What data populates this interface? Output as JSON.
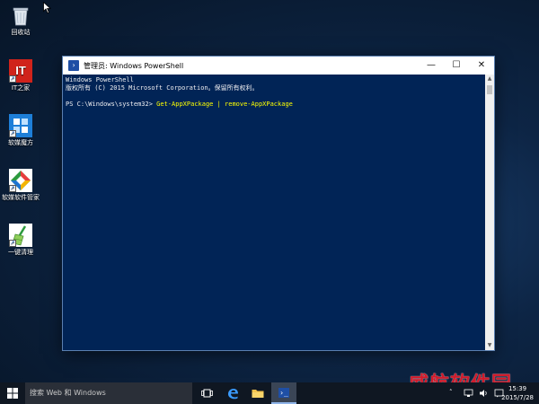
{
  "desktop": {
    "icons": [
      {
        "label": "回收站"
      },
      {
        "label": "IT之家",
        "glyph_text": "IT"
      },
      {
        "label": "软媒魔方"
      },
      {
        "label": "软媒软件管家"
      },
      {
        "label": "一键清理"
      }
    ]
  },
  "window": {
    "title": "管理员: Windows PowerShell",
    "minimize": "—",
    "maximize": "☐",
    "close": "✕"
  },
  "console": {
    "line1": "Windows PowerShell",
    "line2": "版权所有 (C) 2015 Microsoft Corporation。保留所有权利。",
    "prompt": "PS C:\\Windows\\system32> ",
    "command": "Get-AppXPackage | remove-AppXPackage"
  },
  "taskbar": {
    "search_placeholder": "搜索 Web 和 Windows",
    "time": "15:39",
    "date": "2015/7/28"
  },
  "watermark": "威航软件园",
  "colors": {
    "console_bg": "#012456",
    "command_text": "#ffff00",
    "taskbar": "#0f1722"
  }
}
